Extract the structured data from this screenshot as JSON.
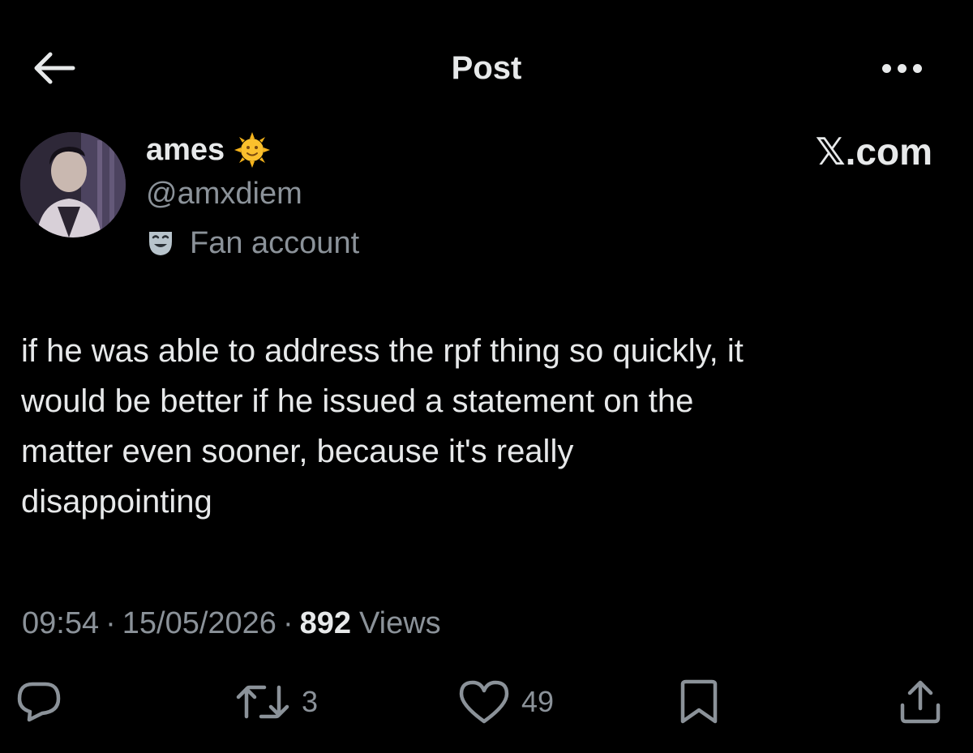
{
  "header": {
    "title": "Post"
  },
  "author": {
    "display_name": "ames",
    "name_emoji": "🌞",
    "handle": "@amxdiem",
    "label": "Fan account"
  },
  "watermark": "𝕏.com",
  "post": {
    "text": "if he was able to address the rpf thing so quickly, it\nwould be better if he issued a statement on the\nmatter even sooner, because it's really\ndisappointing"
  },
  "meta": {
    "time": "09:54",
    "separator": "·",
    "date": "15/05/2026",
    "views_count": "892",
    "views_label": "Views"
  },
  "actions": {
    "reply_count": "",
    "repost_count": "3",
    "like_count": "49"
  },
  "colors": {
    "background": "#000000",
    "primary_text": "#e7e9ea",
    "secondary_text": "#8b9299"
  },
  "icons": {
    "back": "arrow-left-icon",
    "more": "more-dots-icon",
    "label": "theater-mask-icon",
    "reply": "reply-icon",
    "repost": "repost-icon",
    "like": "heart-icon",
    "bookmark": "bookmark-icon",
    "share": "share-icon"
  }
}
